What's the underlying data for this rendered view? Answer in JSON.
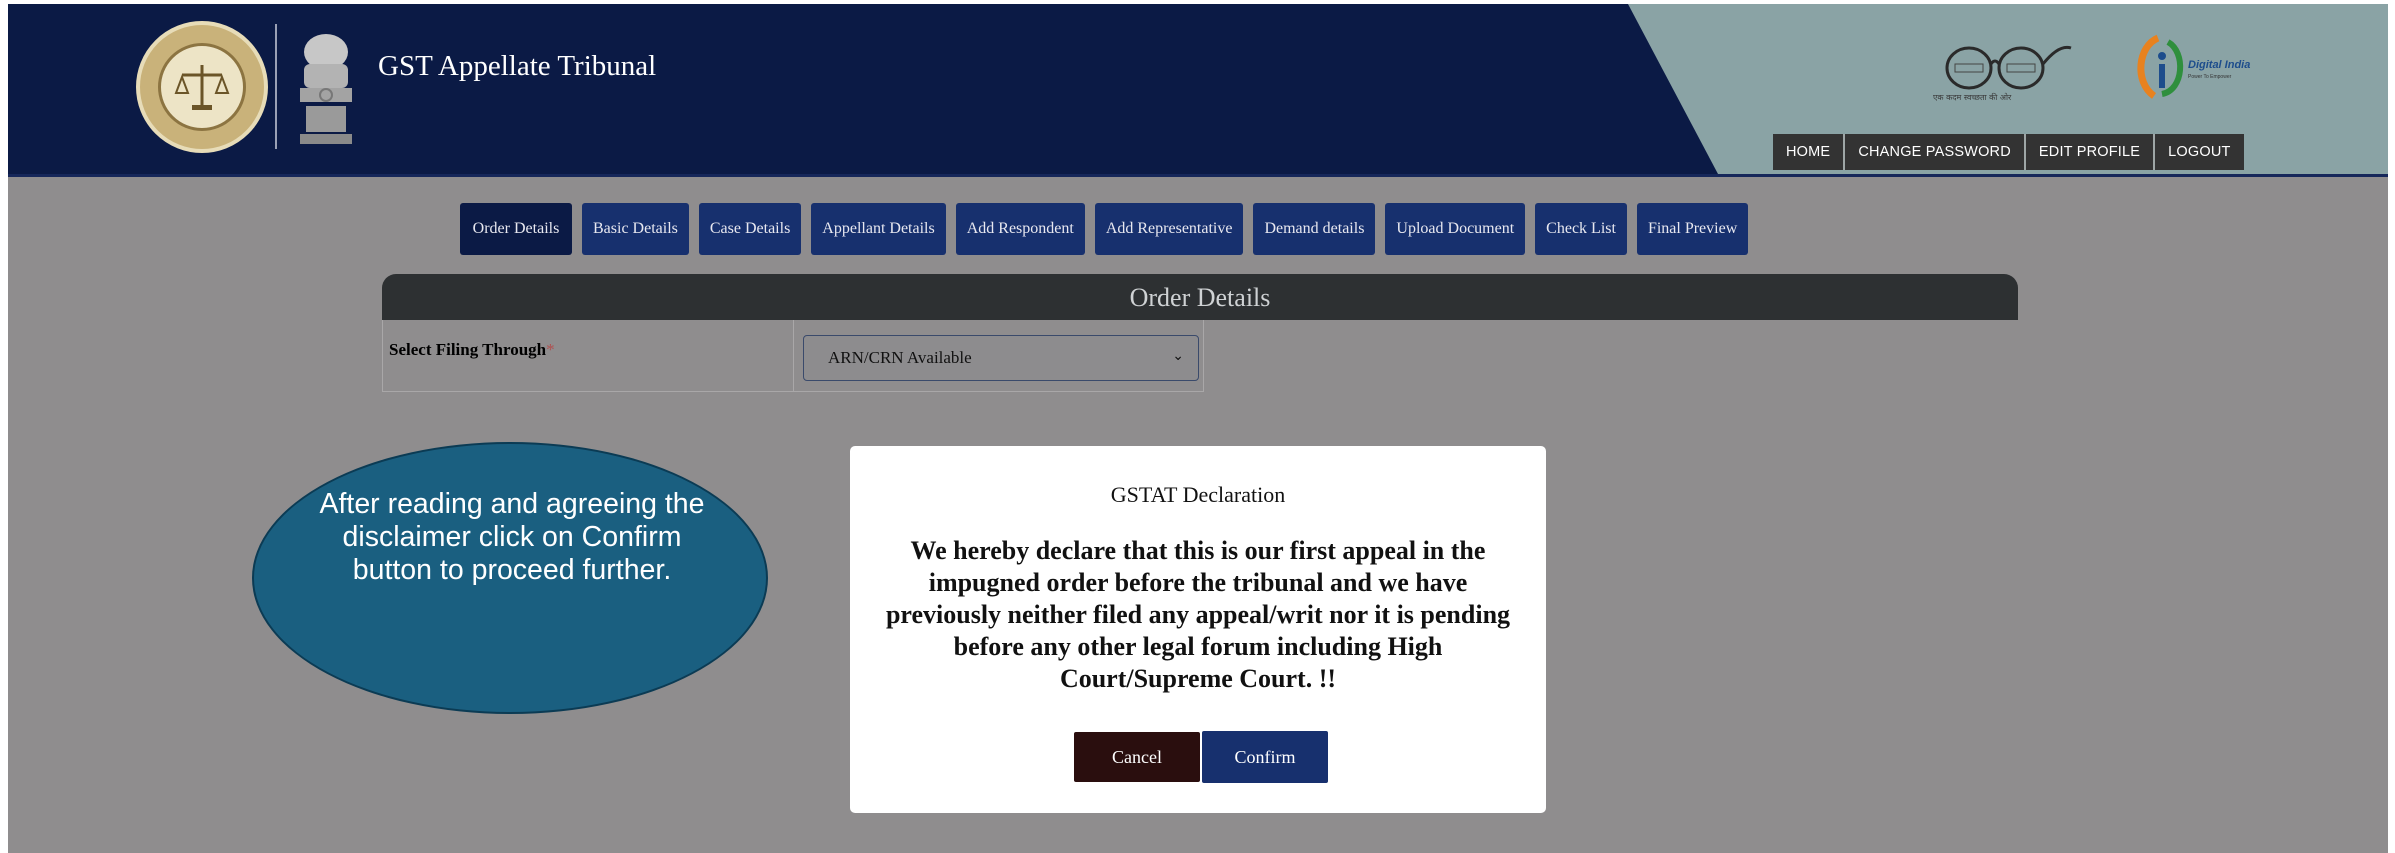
{
  "header": {
    "title": "GST Appellate Tribunal",
    "emblem_text": "GST APPELLATE TRIBUNAL",
    "azadi_tagline": "एक कदम स्वच्छता की ओर",
    "digital_india": "Digital India",
    "digital_india_sub": "Power To Empower",
    "nav": [
      "HOME",
      "CHANGE PASSWORD",
      "EDIT PROFILE",
      "LOGOUT"
    ]
  },
  "tabs": [
    "Order Details",
    "Basic Details",
    "Case Details",
    "Appellant Details",
    "Add Respondent",
    "Add Representative",
    "Demand details",
    "Upload Document",
    "Check List",
    "Final Preview"
  ],
  "panel": {
    "title": "Order Details",
    "filing_label": "Select Filing Through",
    "required_mark": "*",
    "filing_value": "ARN/CRN Available"
  },
  "callout": {
    "text": "After reading and agreeing the disclaimer click on Confirm button to proceed further."
  },
  "modal": {
    "title": "GSTAT Declaration",
    "body": "We hereby declare that this is our first appeal in the impugned order before the tribunal and we have previously neither filed any appeal/writ nor it is pending before any other legal forum including High Court/Supreme Court. !!",
    "cancel_label": "Cancel",
    "confirm_label": "Confirm"
  },
  "colors": {
    "header_bg": "#0b1a45",
    "tab_bg": "#17306e",
    "overlay": "#8f8d8e",
    "callout": "#1a5f80"
  }
}
